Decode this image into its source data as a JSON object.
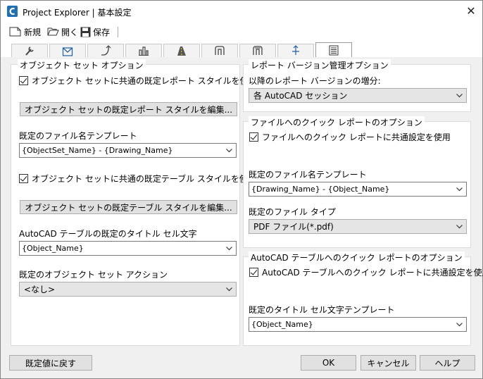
{
  "window": {
    "title": "Project Explorer | 基本設定",
    "close_glyph": "✕"
  },
  "toolbar": {
    "new_label": "新規",
    "open_label": "開く",
    "save_label": "保存"
  },
  "tabs": [
    {
      "icon": "wrench-icon"
    },
    {
      "icon": "sheet-icon"
    },
    {
      "icon": "alignment-icon"
    },
    {
      "icon": "structure-icon"
    },
    {
      "icon": "road-icon"
    },
    {
      "icon": "pipe-icon"
    },
    {
      "icon": "pressure-pipe-icon"
    },
    {
      "icon": "survey-icon"
    },
    {
      "icon": "report-icon",
      "active": true
    }
  ],
  "left_group": {
    "title": "オブジェクト セット オプション",
    "common_report_style_check": "オブジェクト セットに共通の既定レポート スタイルを使用",
    "edit_report_style_button": "オブジェクト セットの既定レポート スタイルを編集...",
    "filename_template_label": "既定のファイル名テンプレート",
    "filename_template_value": "{ObjectSet_Name} - {Drawing_Name}",
    "common_table_style_check": "オブジェクト セットに共通の既定テーブル スタイルを使用",
    "edit_table_style_button": "オブジェクト セットの既定テーブル スタイルを編集...",
    "title_cell_label": "AutoCAD テーブルの既定のタイトル セル文字",
    "title_cell_value": "{Object_Name}",
    "action_label": "既定のオブジェクト セット アクション",
    "action_value": "<なし>"
  },
  "version_group": {
    "title": "レポート バージョン管理オプション",
    "increment_label": "以降のレポート バージョンの増分:",
    "increment_value": "各 AutoCAD セッション"
  },
  "quick_file_group": {
    "title": "ファイルへのクイック レポートのオプション",
    "common_check": "ファイルへのクイック レポートに共通設定を使用",
    "filename_template_label": "既定のファイル名テンプレート",
    "filename_template_value": "{Drawing_Name} - {Object_Name}",
    "file_type_label": "既定のファイル タイプ",
    "file_type_value": "PDF ファイル(*.pdf)"
  },
  "quick_table_group": {
    "title": "AutoCAD テーブルへのクイック レポートのオプション",
    "common_check": "AutoCAD テーブルへのクイック レポートに共通設定を使用",
    "title_template_label": "既定のタイトル セル文字テンプレート",
    "title_template_value": "{Object_Name}"
  },
  "footer": {
    "reset_label": "既定値に戻す",
    "ok_label": "OK",
    "cancel_label": "キャンセル",
    "help_label": "ヘルプ"
  }
}
